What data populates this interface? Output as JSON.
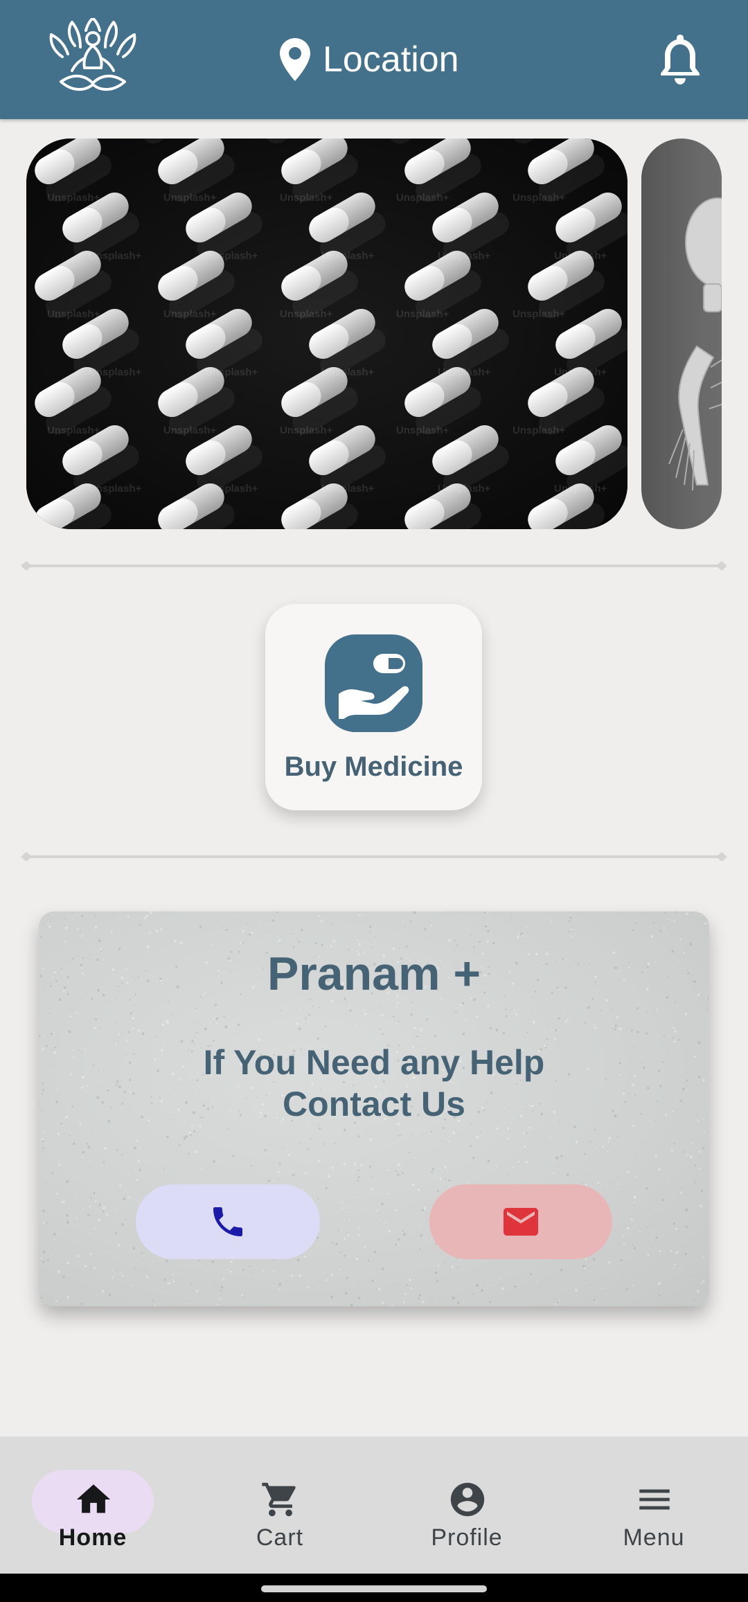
{
  "header": {
    "location_label": "Location",
    "icons": {
      "logo": "lotus-meditation-logo",
      "location": "location-pin-icon",
      "notifications": "bell-icon"
    },
    "bg_color": "#43708a"
  },
  "carousel": {
    "watermark_text": "Unsplash+"
  },
  "services": {
    "buy_medicine_label": "Buy Medicine",
    "icon": "hand-holding-pill-icon"
  },
  "help_card": {
    "title": "Pranam +",
    "subtitle_line1": "If You Need any Help",
    "subtitle_line2": "Contact Us",
    "call_icon": "phone-icon",
    "mail_icon": "mail-icon",
    "call_color": "#1c1aa8",
    "mail_color": "#e0343c"
  },
  "bottom_nav": {
    "items": [
      {
        "label": "Home",
        "icon": "home-icon",
        "active": true
      },
      {
        "label": "Cart",
        "icon": "cart-icon",
        "active": false
      },
      {
        "label": "Profile",
        "icon": "account-circle-icon",
        "active": false
      },
      {
        "label": "Menu",
        "icon": "menu-icon",
        "active": false
      }
    ]
  }
}
